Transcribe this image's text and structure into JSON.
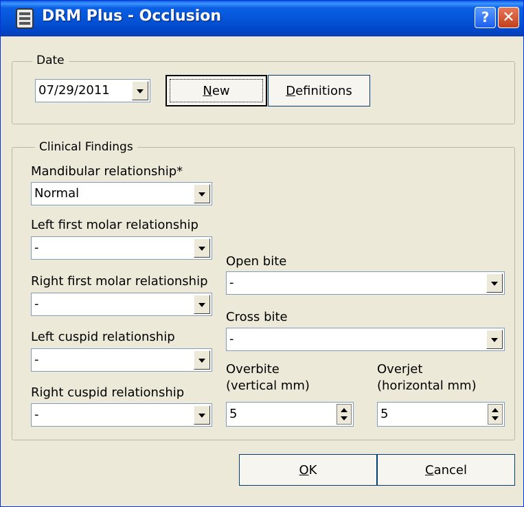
{
  "window": {
    "title": "DRM Plus - Occlusion",
    "help_glyph": "?",
    "close_glyph": "✕",
    "accent": "#0553d6"
  },
  "date_group": {
    "label": "Date",
    "date_value": "07/29/2011",
    "new_button": {
      "mnemonic": "N",
      "rest": "ew"
    },
    "definitions_button": {
      "mnemonic": "D",
      "rest": "efinitions"
    }
  },
  "clinical": {
    "label": "Clinical Findings",
    "mandibular": {
      "label": "Mandibular relationship*",
      "value": "Normal"
    },
    "left_first_molar": {
      "label": "Left first molar relationship",
      "value": "-"
    },
    "right_first_molar": {
      "label": "Right first molar relationship",
      "value": "-"
    },
    "left_cuspid": {
      "label": "Left cuspid relationship",
      "value": "-"
    },
    "right_cuspid": {
      "label": "Right cuspid relationship",
      "value": "-"
    },
    "open_bite": {
      "label": "Open bite",
      "value": "-"
    },
    "cross_bite": {
      "label": "Cross bite",
      "value": "-"
    },
    "overbite": {
      "label_line1": "Overbite",
      "label_line2": "(vertical mm)",
      "value": "5"
    },
    "overjet": {
      "label_line1": "Overjet",
      "label_line2": "(horizontal mm)",
      "value": "5"
    }
  },
  "footer": {
    "ok_button": {
      "mnemonic": "O",
      "rest": "K"
    },
    "cancel_button": {
      "mnemonic": "C",
      "rest": "ancel"
    }
  }
}
